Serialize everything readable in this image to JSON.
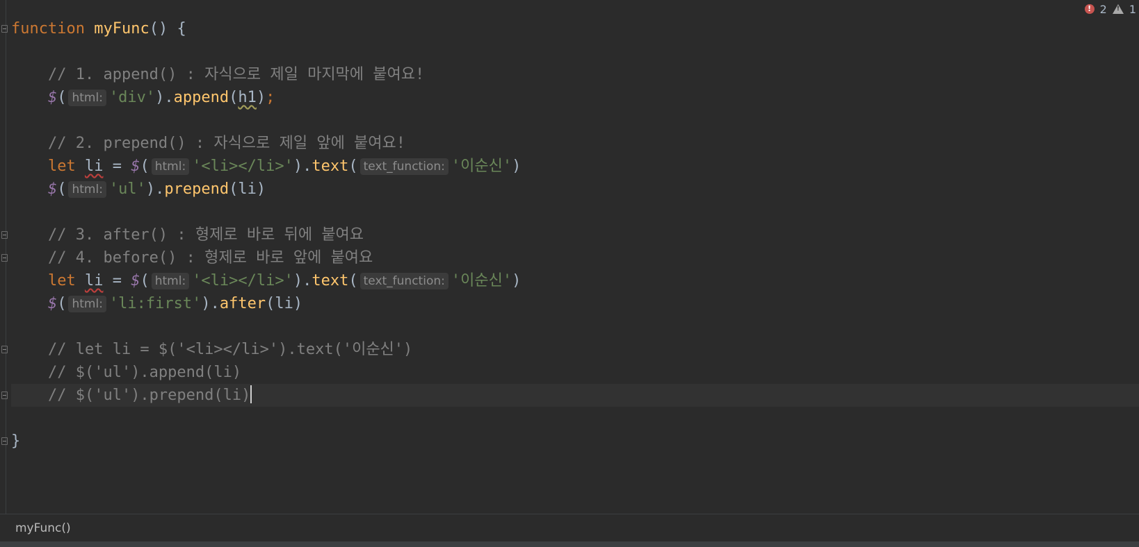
{
  "status": {
    "errors": "2",
    "warnings": "1"
  },
  "breadcrumb": "myFunc()",
  "code": {
    "kw_function": "function",
    "func_name": "myFunc",
    "func_sig_rest": "() {",
    "c1": "// 1. append() : 자식으로 제일 마지막에 붙여요!",
    "hint_html": "html:",
    "hint_text_function": "text_function:",
    "s_div": "'div'",
    "m_append": "append",
    "v_h1": "h1",
    "c2": "// 2. prepend() : 자식으로 제일 앞에 붙여요!",
    "kw_let": "let",
    "v_li": "li",
    "s_li_tag": "'<li></li>'",
    "m_text": "text",
    "s_name": "'이순신'",
    "s_ul": "'ul'",
    "m_prepend": "prepend",
    "c3": "// 3. after() : 형제로 바로 뒤에 붙여요",
    "c4": "// 4. before() : 형제로 바로 앞에 붙여요",
    "s_li_first": "'li:first'",
    "m_after": "after",
    "c5": "// let li = $('<li></li>').text('이순신')",
    "c6": "// $('ul').append(li)",
    "c7": "// $('ul').prepend(li)",
    "close_brace": "}"
  }
}
